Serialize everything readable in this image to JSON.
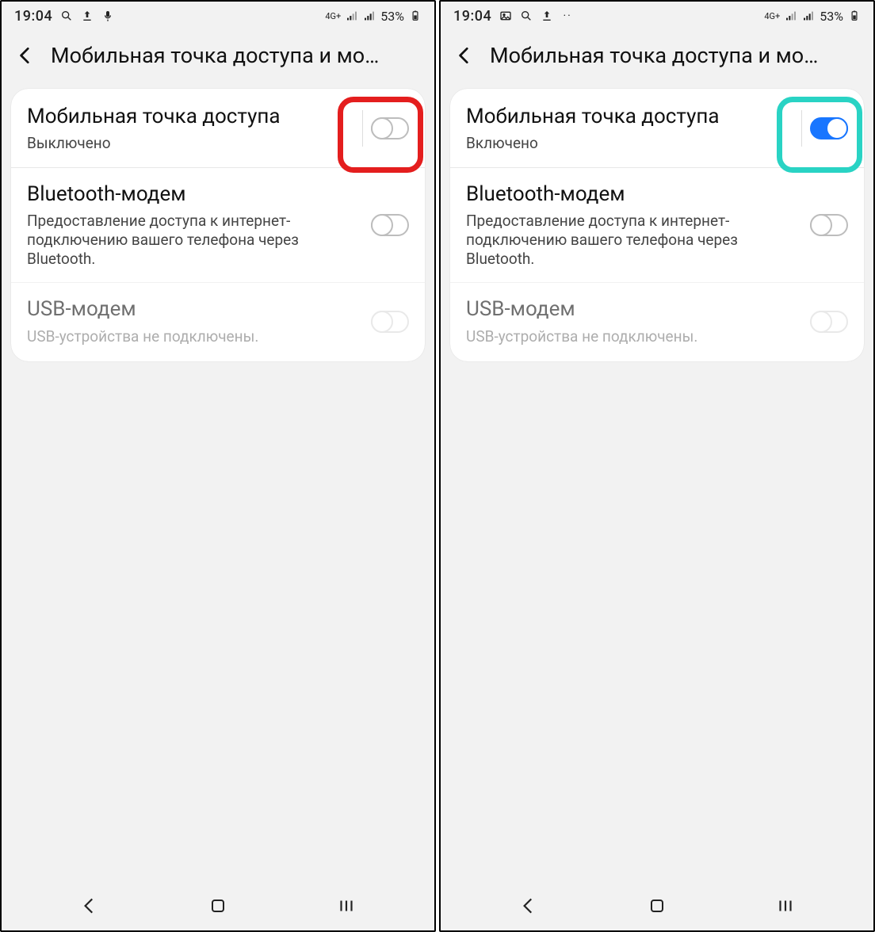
{
  "left": {
    "status": {
      "time": "19:04",
      "icons_left": [
        "search-icon",
        "upload-icon",
        "mic-icon"
      ],
      "net": "4G+",
      "battery": "53%"
    },
    "title": "Мобильная точка доступа и мо…",
    "hotspot": {
      "title": "Мобильная точка доступа",
      "sub": "Выключено",
      "on": false
    },
    "bt": {
      "title": "Bluetooth-модем",
      "sub": "Предоставление доступа к интернет-подключению вашего телефона через Bluetooth.",
      "on": false
    },
    "usb": {
      "title": "USB-модем",
      "sub": "USB-устройства не подключены.",
      "on": false,
      "disabled": true
    },
    "highlight_color": "red"
  },
  "right": {
    "status": {
      "time": "19:04",
      "icons_left": [
        "image-icon",
        "search-icon",
        "upload-icon",
        "more-icon"
      ],
      "net": "4G+",
      "battery": "53%"
    },
    "title": "Мобильная точка доступа и мо…",
    "hotspot": {
      "title": "Мобильная точка доступа",
      "sub": "Включено",
      "on": true
    },
    "bt": {
      "title": "Bluetooth-модем",
      "sub": "Предоставление доступа к интернет-подключению вашего телефона через Bluetooth.",
      "on": false
    },
    "usb": {
      "title": "USB-модем",
      "sub": "USB-устройства не подключены.",
      "on": false,
      "disabled": true
    },
    "highlight_color": "teal"
  }
}
